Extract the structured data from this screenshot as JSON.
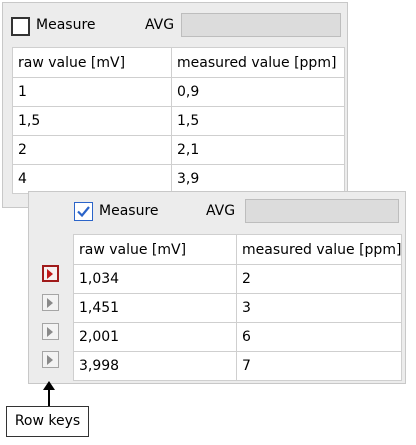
{
  "top_panel": {
    "measure_label": "Measure",
    "measure_checked": false,
    "avg_label": "AVG",
    "avg_value": "",
    "columns": [
      "raw value [mV]",
      "measured value [ppm]"
    ],
    "rows": [
      [
        "1",
        "0,9"
      ],
      [
        "1,5",
        "1,5"
      ],
      [
        "2",
        "2,1"
      ],
      [
        "4",
        "3,9"
      ]
    ]
  },
  "bottom_panel": {
    "measure_label": "Measure",
    "measure_checked": true,
    "avg_label": "AVG",
    "avg_value": "",
    "columns": [
      "raw value [mV]",
      "measured value [ppm]"
    ],
    "rows": [
      [
        "1,034",
        "2"
      ],
      [
        "1,451",
        "3"
      ],
      [
        "2,001",
        "6"
      ],
      [
        "3,998",
        "7"
      ]
    ],
    "active_row_key": 0
  },
  "callout": {
    "label": "Row keys"
  },
  "colors": {
    "panel_bg": "#ececec",
    "checkbox_accent": "#2b64c9",
    "active_row_key": "#c01818"
  }
}
